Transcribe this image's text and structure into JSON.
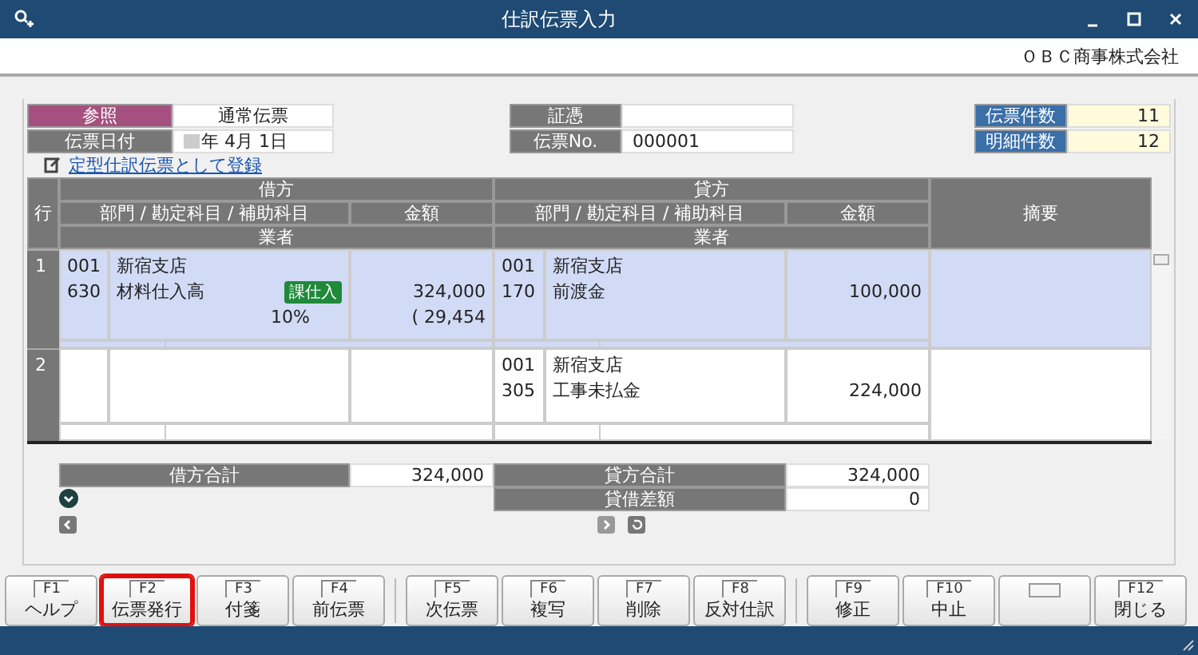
{
  "window": {
    "title": "仕訳伝票入力",
    "company": "ＯＢＣ商事株式会社"
  },
  "header": {
    "ref_label": "参照",
    "ref_value": "通常伝票",
    "date_label": "伝票日付",
    "date_value": "年  4月  1日",
    "voucher_label": "証憑",
    "no_label": "伝票No.",
    "no_value": "000001",
    "counts": [
      {
        "label": "伝票件数",
        "value": "11"
      },
      {
        "label": "明細件数",
        "value": "12"
      }
    ]
  },
  "register_link": "定型仕訳伝票として登録",
  "table": {
    "row_header": "行",
    "debit": "借方",
    "credit": "貸方",
    "account_header": "部門 / 勘定科目 / 補助科目",
    "amount_header": "金額",
    "vendor_header": "業者",
    "credit_account_header": "部門 / 勘定科目 / 補助科目",
    "credit_amount_header": "金額",
    "credit_vendor_header": "業者",
    "memo_header": "摘要",
    "rows": [
      {
        "number": "1",
        "selected": true,
        "debit": {
          "dept_code": "001",
          "dept": "新宿支店",
          "account_code": "630",
          "account": "材料仕入高",
          "tax_tag": "課仕入",
          "tax_rate": "10%",
          "amount": "324,000",
          "tax_amount": "( 29,454"
        },
        "credit": {
          "dept_code": "001",
          "dept": "新宿支店",
          "account_code": "170",
          "account": "前渡金",
          "amount": "100,000"
        }
      },
      {
        "number": "2",
        "selected": false,
        "credit": {
          "dept_code": "001",
          "dept": "新宿支店",
          "account_code": "305",
          "account": "工事未払金",
          "amount": "224,000"
        }
      }
    ]
  },
  "totals": {
    "debit_label": "借方合計",
    "debit_value": "324,000",
    "credit_label": "貸方合計",
    "credit_value": "324,000",
    "diff_label": "貸借差額",
    "diff_value": "0"
  },
  "function_keys": [
    [
      {
        "kind": "key",
        "key": "F1",
        "label": "ヘルプ",
        "highlighted": false
      },
      {
        "kind": "key",
        "key": "F2",
        "label": "伝票発行",
        "highlighted": true
      },
      {
        "kind": "key",
        "key": "F3",
        "label": "付箋",
        "highlighted": false
      },
      {
        "kind": "key",
        "key": "F4",
        "label": "前伝票",
        "highlighted": false
      }
    ],
    [
      {
        "kind": "key",
        "key": "F5",
        "label": "次伝票",
        "highlighted": false
      },
      {
        "kind": "key",
        "key": "F6",
        "label": "複写",
        "highlighted": false
      },
      {
        "kind": "key",
        "key": "F7",
        "label": "削除",
        "highlighted": false
      },
      {
        "kind": "key",
        "key": "F8",
        "label": "反対仕訳",
        "highlighted": false
      }
    ],
    [
      {
        "kind": "key",
        "key": "F9",
        "label": "修正",
        "highlighted": false
      },
      {
        "kind": "key",
        "key": "F10",
        "label": "中止",
        "highlighted": false
      },
      {
        "kind": "empty"
      },
      {
        "kind": "key",
        "key": "F12",
        "label": "閉じる",
        "highlighted": false
      }
    ]
  ]
}
